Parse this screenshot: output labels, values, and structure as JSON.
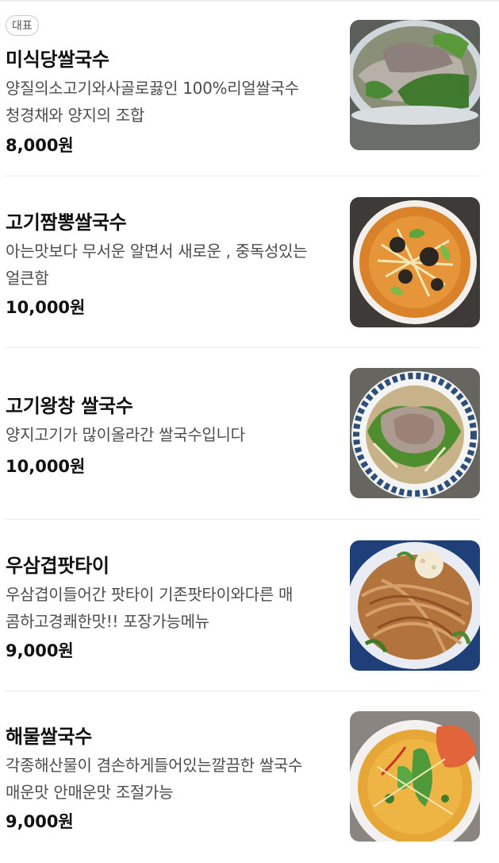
{
  "menu": {
    "items": [
      {
        "badge": "대표",
        "name": "미식당쌀국수",
        "desc_lines": [
          "양질의소고기와사골로끓인 100%리얼쌀국수",
          "청경채와 양지의 조합"
        ],
        "price": "8,000원",
        "image_icon": "pho-beef-bokchoy-photo"
      },
      {
        "name": "고기짬뽕쌀국수",
        "desc_lines": [
          "아는맛보다 무서운 알면서 새로운 , 중독성있는",
          "얼큰함"
        ],
        "price": "10,000원",
        "image_icon": "spicy-jjamppong-pho-photo"
      },
      {
        "name": "고기왕창 쌀국수",
        "desc_lines": [
          "양지고기가 많이올라간 쌀국수입니다"
        ],
        "price": "10,000원",
        "image_icon": "beef-loaded-pho-photo"
      },
      {
        "name": "우삼겹팟타이",
        "desc_lines": [
          "우삼겹이들어간 팟타이 기존팟타이와다른 매",
          "콤하고경쾌한맛!! 포장가능메뉴"
        ],
        "price": "9,000원",
        "image_icon": "beef-brisket-padthai-photo"
      },
      {
        "name": "해물쌀국수",
        "desc_lines": [
          "각종해산물이 겸손하게들어있는깔끔한 쌀국수",
          "매운맛 안매운맛 조절가능"
        ],
        "price": "9,000원",
        "image_icon": "seafood-pho-photo"
      }
    ]
  }
}
